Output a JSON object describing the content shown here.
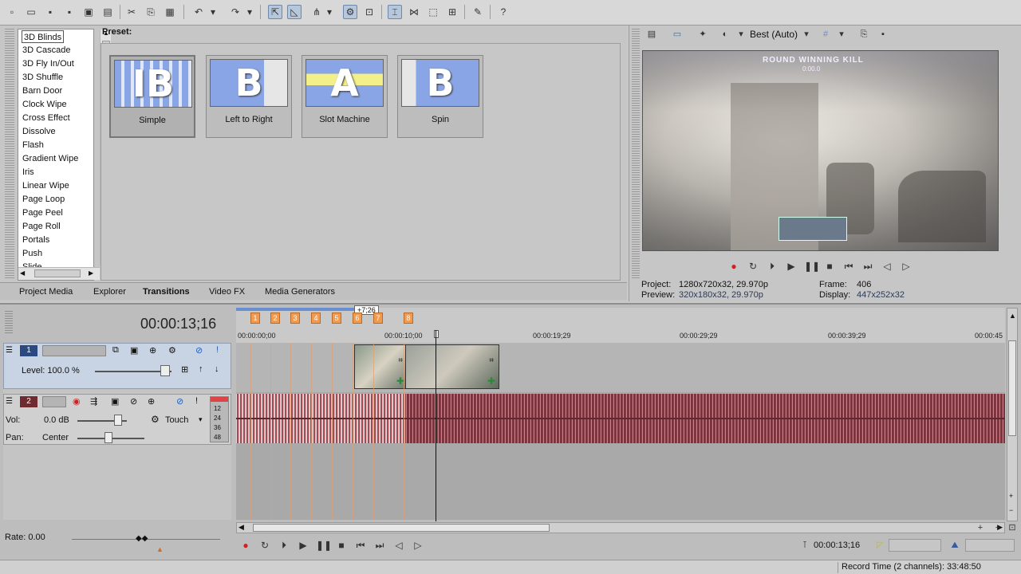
{
  "transitions": {
    "list_items": [
      "3D Blinds",
      "3D Cascade",
      "3D Fly In/Out",
      "3D Shuffle",
      "Barn Door",
      "Clock Wipe",
      "Cross Effect",
      "Dissolve",
      "Flash",
      "Gradient Wipe",
      "Iris",
      "Linear Wipe",
      "Page Loop",
      "Page Peel",
      "Page Roll",
      "Portals",
      "Push",
      "Slide"
    ],
    "preset_label": "Preset:",
    "presets": [
      {
        "label": "Simple",
        "glyph": "IB"
      },
      {
        "label": "Left to Right",
        "glyph": "B"
      },
      {
        "label": "Slot Machine",
        "glyph": "A"
      },
      {
        "label": "Spin",
        "glyph": "B"
      }
    ]
  },
  "tabs": [
    "Project Media",
    "Explorer",
    "Transitions",
    "Video FX",
    "Media Generators"
  ],
  "preview": {
    "quality": "Best (Auto)",
    "video_overlay_text": "ROUND WINNING KILL",
    "video_overlay_sub": "0:00.0",
    "project_label": "Project:",
    "project_value": "1280x720x32, 29.970p",
    "preview_label": "Preview:",
    "preview_value": "320x180x32, 29.970p",
    "frame_label": "Frame:",
    "frame_value": "406",
    "display_label": "Display:",
    "display_value": "447x252x32"
  },
  "timeline": {
    "current_time": "00:00:13;16",
    "selection_length": "+7;26",
    "markers": [
      "1",
      "2",
      "3",
      "4",
      "5",
      "6",
      "7",
      "8"
    ],
    "ruler_times": [
      "00:00:00;00",
      "00:00:10;00",
      "00:00:19;29",
      "00:00:29;29",
      "00:00:39;29",
      "00:00:45"
    ],
    "video_track": {
      "number": "1",
      "level_label": "Level: 100.0 %"
    },
    "audio_track": {
      "number": "2",
      "vol_label": "Vol:",
      "vol_value": "0.0 dB",
      "pan_label": "Pan:",
      "pan_value": "Center",
      "automation": "Touch",
      "meter_labels": [
        "12",
        "24",
        "36",
        "48"
      ]
    },
    "rate": "Rate: 0.00",
    "transport_time": "00:00:13;16"
  },
  "status": {
    "record_time": "Record Time (2 channels): 33:48:50"
  }
}
